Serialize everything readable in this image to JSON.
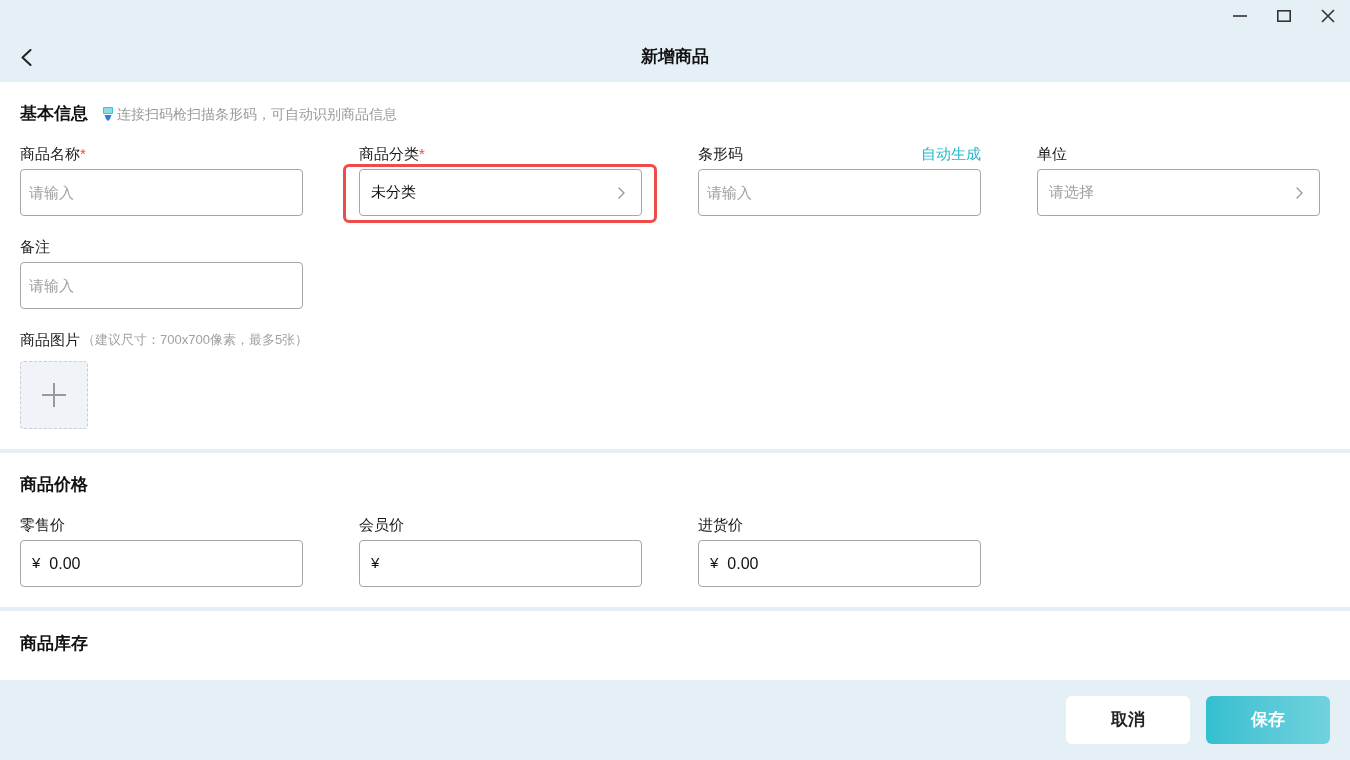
{
  "window": {
    "title": "新增商品"
  },
  "sections": [
    {
      "title": "基本信息",
      "hint": "连接扫码枪扫描条形码，可自动识别商品信息",
      "fields": [
        {
          "kind": "text",
          "label": "商品名称",
          "mark": "*",
          "placeholder": "请输入",
          "highlighted": false
        },
        {
          "kind": "select",
          "label": "商品分类",
          "mark": "*",
          "value": "未分类",
          "highlighted": true
        },
        {
          "kind": "text",
          "label": "条形码",
          "action": "自动生成",
          "placeholder": "请输入",
          "highlighted": false
        },
        {
          "kind": "select",
          "label": "单位",
          "placeholder": "请选择",
          "highlighted": false
        },
        {
          "kind": "text",
          "label": "备注",
          "placeholder": "请输入",
          "highlighted": false
        }
      ],
      "images": {
        "label": "商品图片",
        "hint": "（建议尺寸：700x700像素，最多5张）"
      }
    },
    {
      "title": "商品价格",
      "fields": [
        {
          "kind": "price",
          "label": "零售价",
          "prefix": "¥",
          "value": "0.00",
          "highlighted": false
        },
        {
          "kind": "price",
          "label": "会员价",
          "prefix": "¥",
          "highlighted": false
        },
        {
          "kind": "price",
          "label": "进货价",
          "prefix": "¥",
          "value": "0.00",
          "highlighted": false
        }
      ]
    },
    {
      "title": "商品库存"
    }
  ],
  "footer": {
    "buttons": [
      {
        "kind": "secondary",
        "label": "取消"
      },
      {
        "kind": "primary",
        "label": "保存"
      }
    ]
  }
}
